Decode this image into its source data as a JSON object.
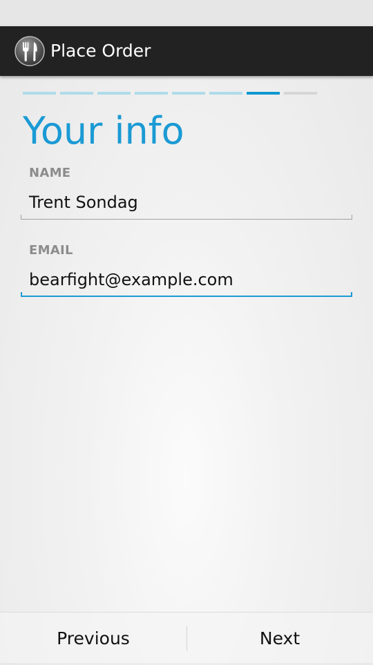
{
  "colors": {
    "accent": "#1a9ad4",
    "action_bar": "#222222",
    "step_done": "#aedbe9",
    "step_current": "#0e97cf",
    "step_todo": "#d6d6d6",
    "label_gray": "#8c8c8c"
  },
  "action_bar": {
    "icon": "fork-knife-icon",
    "title": "Place Order"
  },
  "progress": {
    "total_steps": 8,
    "current_step": 7
  },
  "page": {
    "title": "Your info"
  },
  "form": {
    "name": {
      "label": "NAME",
      "value": "Trent Sondag"
    },
    "email": {
      "label": "EMAIL",
      "value": "bearfight@example.com",
      "focused": true
    }
  },
  "navigation": {
    "previous_label": "Previous",
    "next_label": "Next"
  }
}
